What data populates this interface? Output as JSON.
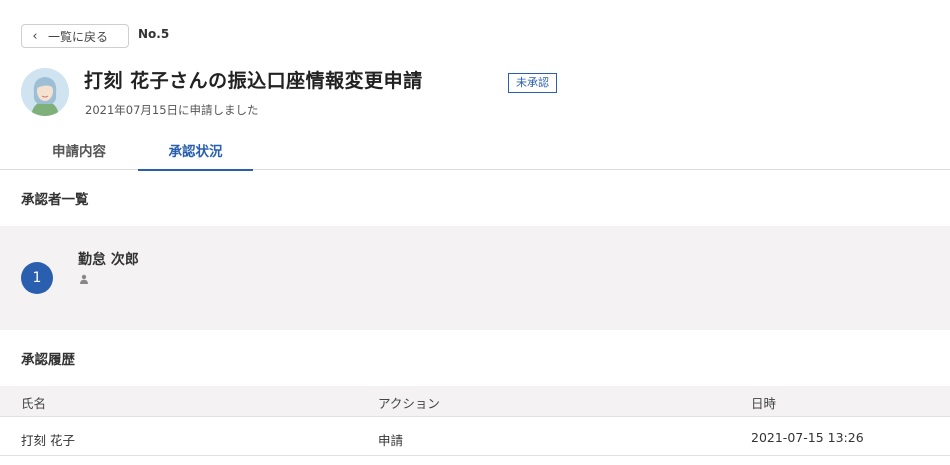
{
  "header": {
    "back_label": "一覧に戻る",
    "request_no": "No.5"
  },
  "request": {
    "title": "打刻 花子さんの振込口座情報変更申請",
    "status": "未承認",
    "submitted": "2021年07月15日に申請しました"
  },
  "tabs": [
    {
      "label": "申請内容",
      "active": false
    },
    {
      "label": "承認状況",
      "active": true
    }
  ],
  "approvers_section": {
    "title": "承認者一覧",
    "items": [
      {
        "step": "1",
        "name": "勤怠 次郎",
        "icon": "person-icon"
      }
    ]
  },
  "history_section": {
    "title": "承認履歴",
    "columns": [
      "氏名",
      "アクション",
      "日時"
    ],
    "rows": [
      {
        "name": "打刻 花子",
        "action": "申請",
        "datetime": "2021-07-15 13:26"
      }
    ]
  },
  "colors": {
    "accent": "#2a5fb0",
    "panel_bg": "#f4f2f2"
  }
}
